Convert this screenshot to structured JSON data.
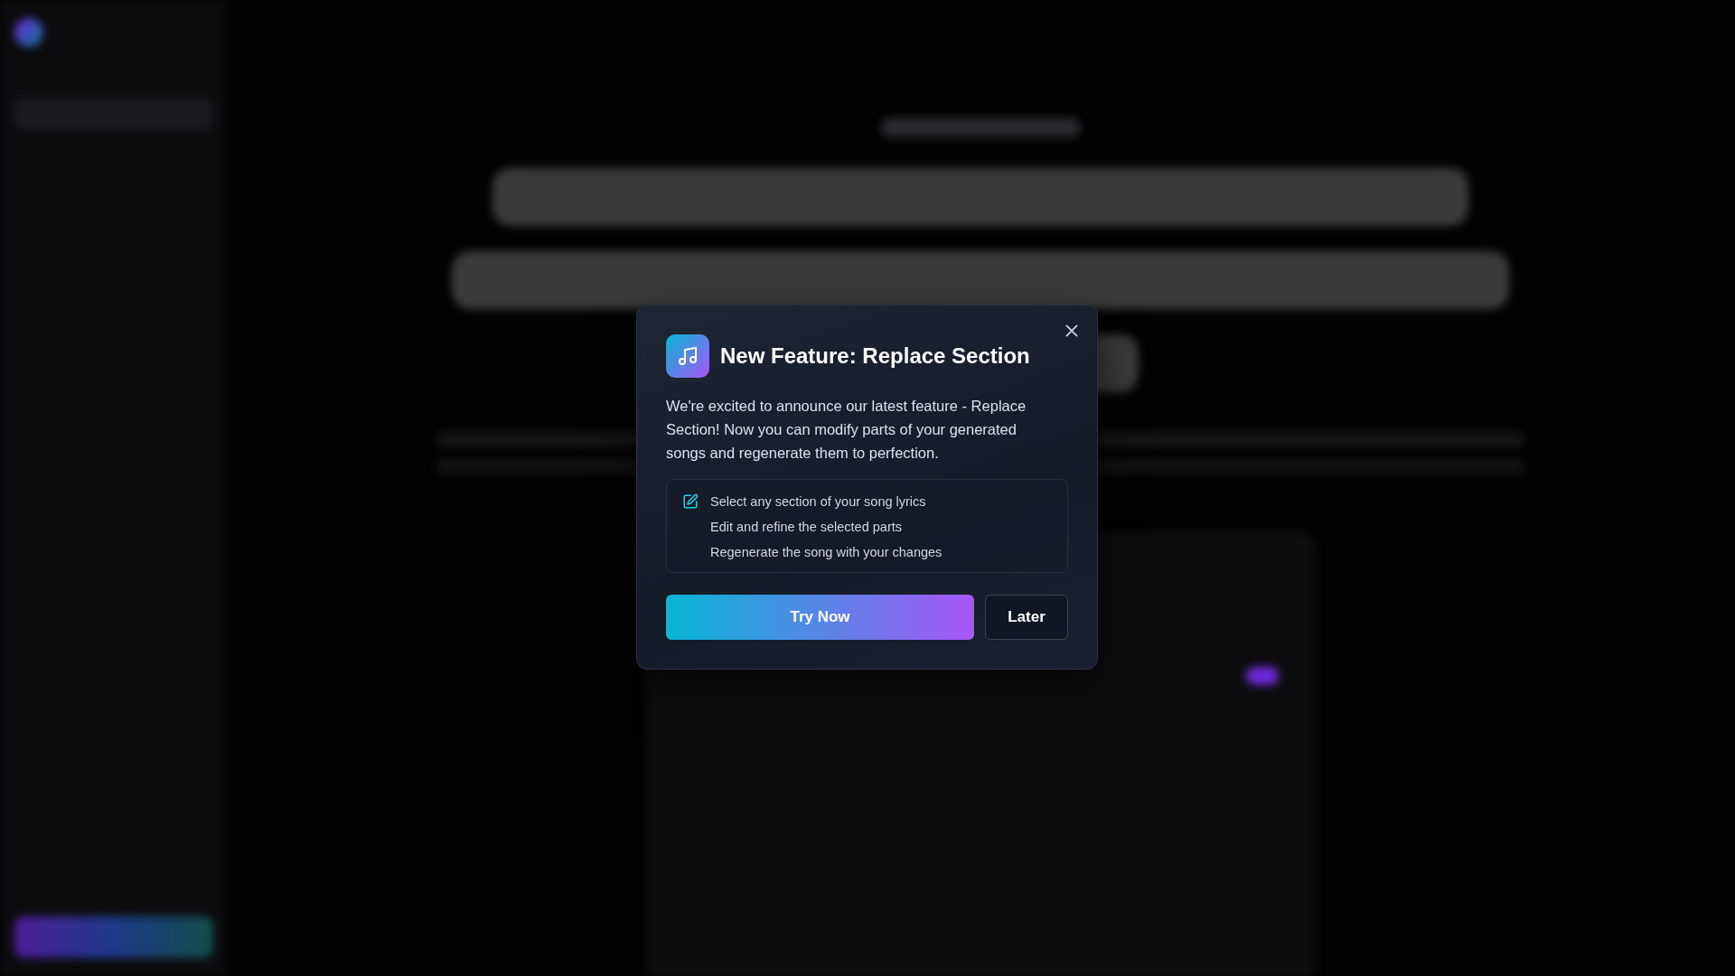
{
  "modal": {
    "title": "New Feature: Replace Section",
    "description": "We're excited to announce our latest feature - Replace Section! Now you can modify parts of your generated songs and regenerate them to perfection.",
    "features": [
      {
        "text": "Select any section of your song lyrics",
        "icon": true
      },
      {
        "text": "Edit and refine the selected parts",
        "icon": false
      },
      {
        "text": "Regenerate the song with your changes",
        "icon": false
      }
    ],
    "buttons": [
      {
        "label": "Try Now",
        "kind": "primary"
      },
      {
        "label": "Later",
        "kind": "secondary"
      }
    ]
  }
}
